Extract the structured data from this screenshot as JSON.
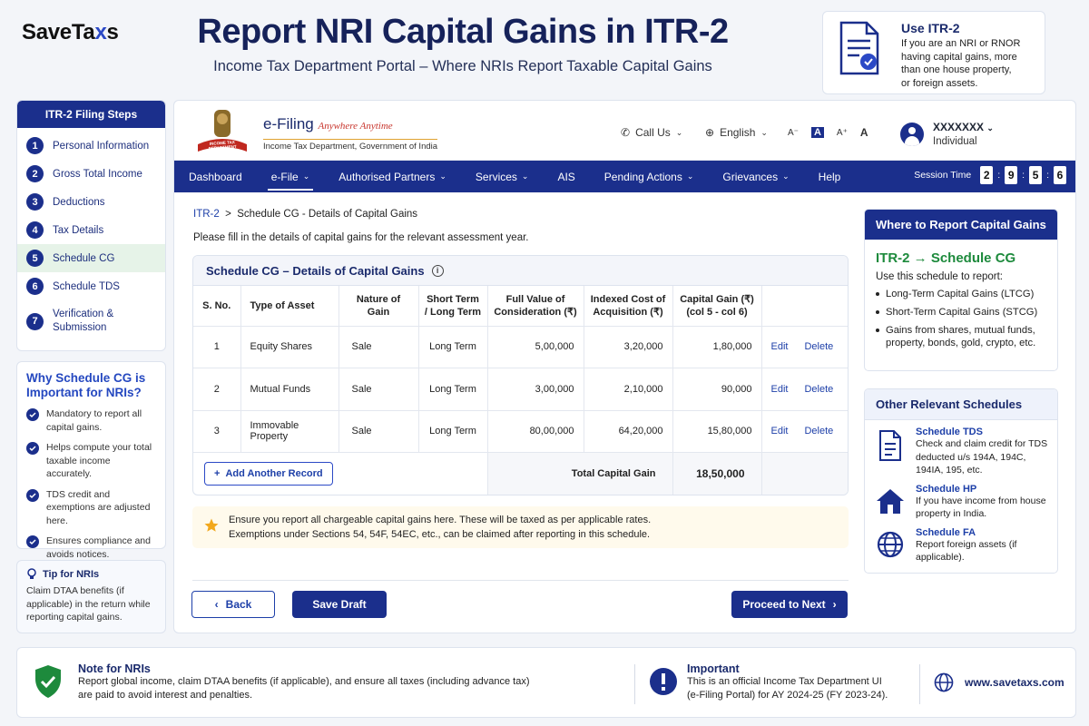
{
  "brand": {
    "pre": "SaveTa",
    "x": "x",
    "post": "s"
  },
  "title": "Report NRI Capital Gains in ITR-2",
  "subtitle": "Income Tax Department Portal – Where NRIs Report Taxable Capital Gains",
  "use_card": {
    "title": "Use ITR-2",
    "lines": [
      "If you are an NRI or RNOR",
      "having capital gains, more",
      "than one house property,",
      "or foreign assets."
    ]
  },
  "steps": {
    "heading": "ITR-2 Filing Steps",
    "items": [
      {
        "n": "1",
        "label": "Personal Information"
      },
      {
        "n": "2",
        "label": "Gross Total Income"
      },
      {
        "n": "3",
        "label": "Deductions"
      },
      {
        "n": "4",
        "label": "Tax Details"
      },
      {
        "n": "5",
        "label": "Schedule CG"
      },
      {
        "n": "6",
        "label": "Schedule TDS"
      },
      {
        "n": "7",
        "label": "Verification & Submission"
      }
    ]
  },
  "why": {
    "heading": "Why Schedule CG is Important for NRIs?",
    "items": [
      "Mandatory to report all capital gains.",
      "Helps compute your total taxable income accurately.",
      "TDS credit and exemptions are adjusted here.",
      "Ensures compliance and avoids notices."
    ]
  },
  "tip": {
    "heading": "Tip for NRIs",
    "text": "Claim DTAA benefits (if applicable) in the return while reporting capital gains."
  },
  "portal": {
    "efiling_title": "e-Filing",
    "efiling_tag": "Anywhere Anytime",
    "efiling_sub": "Income Tax Department, Government of India",
    "emblem_label": "INCOME TAX DEPARTMENT",
    "call_us": "Call Us",
    "language": "English",
    "font_sizes": [
      "A⁻",
      "A",
      "A⁺",
      "A"
    ],
    "user_name": "XXXXXXX",
    "user_role": "Individual",
    "nav": [
      "Dashboard",
      "e-File",
      "Authorised Partners",
      "Services",
      "AIS",
      "Pending Actions",
      "Grievances",
      "Help"
    ],
    "session_label": "Session Time",
    "session_digits": [
      "2",
      "9",
      "5",
      "6"
    ],
    "breadcrumb_root": "ITR-2",
    "breadcrumb_sep": ">",
    "breadcrumb_page": "Schedule CG - Details of Capital Gains",
    "intro": "Please fill in the details of capital gains for the relevant assessment year."
  },
  "cg_table": {
    "heading": "Schedule CG – Details of Capital Gains",
    "columns": [
      "S. No.",
      "Type of Asset",
      "Nature of Gain",
      "Short Term / Long Term",
      "Full Value of Consideration (₹)",
      "Indexed Cost of Acquisition (₹)",
      "Capital Gain (₹) (col 5 - col 6)",
      ""
    ],
    "rows": [
      {
        "sno": "1",
        "asset": "Equity Shares",
        "nature": "Sale",
        "term": "Long Term",
        "consideration": "5,00,000",
        "cost": "3,20,000",
        "gain": "1,80,000"
      },
      {
        "sno": "2",
        "asset": "Mutual Funds",
        "nature": "Sale",
        "term": "Long Term",
        "consideration": "3,00,000",
        "cost": "2,10,000",
        "gain": "90,000"
      },
      {
        "sno": "3",
        "asset": "Immovable Property",
        "nature": "Sale",
        "term": "Long Term",
        "consideration": "80,00,000",
        "cost": "64,20,000",
        "gain": "15,80,000"
      }
    ],
    "edit_label": "Edit",
    "delete_label": "Delete",
    "add_label": "Add Another Record",
    "total_label": "Total Capital Gain",
    "total_value": "18,50,000"
  },
  "note": {
    "line1": "Ensure you report all chargeable capital gains here.  These will be taxed as per applicable rates.",
    "line2": "Exemptions under Sections 54, 54F, 54EC, etc., can be claimed after reporting in this schedule."
  },
  "buttons": {
    "back": "Back",
    "draft": "Save Draft",
    "next": "Proceed to Next"
  },
  "where": {
    "heading": "Where to Report Capital Gains",
    "big": "ITR-2 → Schedule CG",
    "intro": "Use this schedule to report:",
    "items": [
      "Long-Term Capital Gains (LTCG)",
      "Short-Term Capital Gains (STCG)",
      "Gains from shares, mutual funds, property, bonds, gold, crypto, etc."
    ]
  },
  "other": {
    "heading": "Other Relevant Schedules",
    "items": [
      {
        "title": "Schedule TDS",
        "desc": "Check and claim credit for TDS deducted u/s 194A, 194C, 194IA, 195, etc."
      },
      {
        "title": "Schedule HP",
        "desc": "If you have income from house property in India."
      },
      {
        "title": "Schedule FA",
        "desc": "Report foreign assets (if applicable)."
      }
    ]
  },
  "footer": {
    "note_title": "Note for NRIs",
    "note_l1": "Report global income, claim DTAA benefits (if applicable), and ensure all taxes (including advance tax)",
    "note_l2": "are paid to avoid interest and penalties.",
    "imp_title": "Important",
    "imp_l1": "This is an official Income Tax Department UI",
    "imp_l2": "(e-Filing Portal) for AY 2024-25 (FY 2023-24).",
    "site": "www.savetaxs.com"
  },
  "colors": {
    "navy": "#1b2f8c",
    "green": "#1d8a3c",
    "accent": "#2b49c6"
  }
}
